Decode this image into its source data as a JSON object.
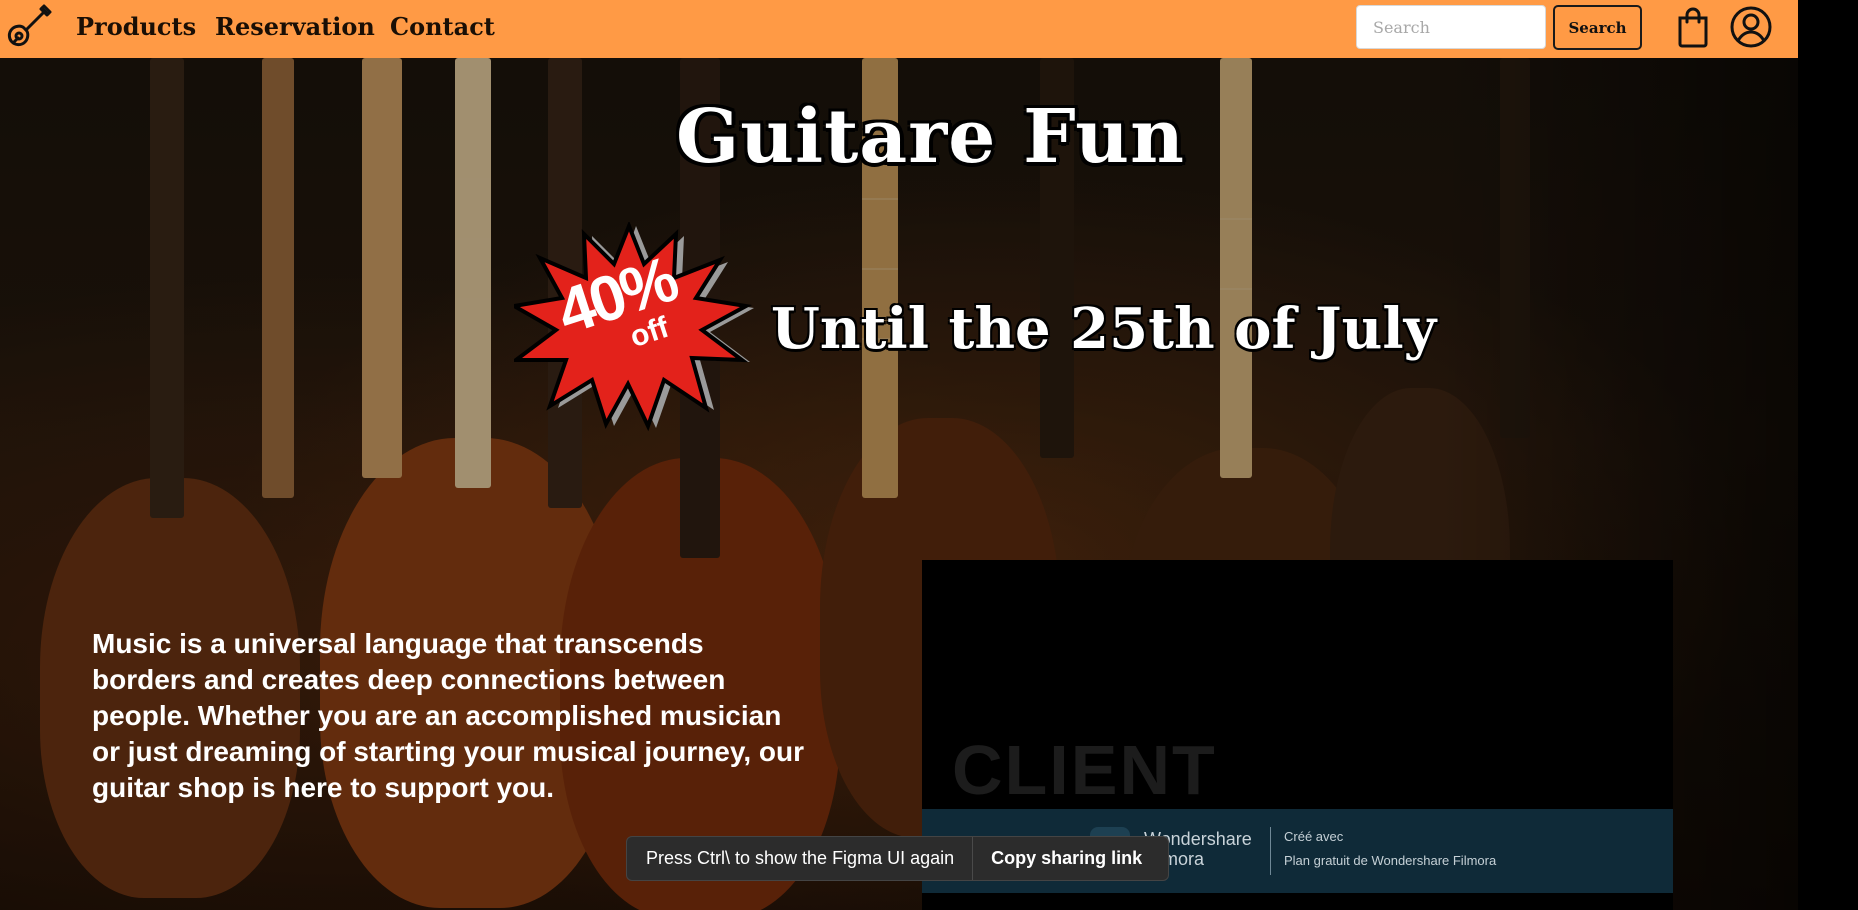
{
  "nav": {
    "links": [
      "Products",
      "Reservation",
      "Contact"
    ],
    "search_placeholder": "Search",
    "search_button": "Search"
  },
  "hero": {
    "title": "Guitare Fun",
    "badge_percent": "40%",
    "badge_off": "off",
    "promo": "Until the 25th of July",
    "paragraph": "Music is a universal language that transcends borders and creates deep connections between people. Whether you are an accomplished musician or just dreaming of starting your musical journey, our guitar shop is here to support you."
  },
  "video": {
    "overlay_text": "CLIENT",
    "watermark_name_line1": "Wondershare",
    "watermark_name_line2": "Filmora",
    "watermark_created": "Créé avec",
    "watermark_plan": "Plan gratuit de Wondershare Filmora"
  },
  "figma_toast": {
    "message": "Press Ctrl\\ to show the Figma UI again",
    "button": "Copy sharing link"
  },
  "colors": {
    "nav_bg": "#ff9a45",
    "badge_red": "#e3221b",
    "watermark_bg": "#0f2a38",
    "toast_bg": "#2c2c2c"
  }
}
